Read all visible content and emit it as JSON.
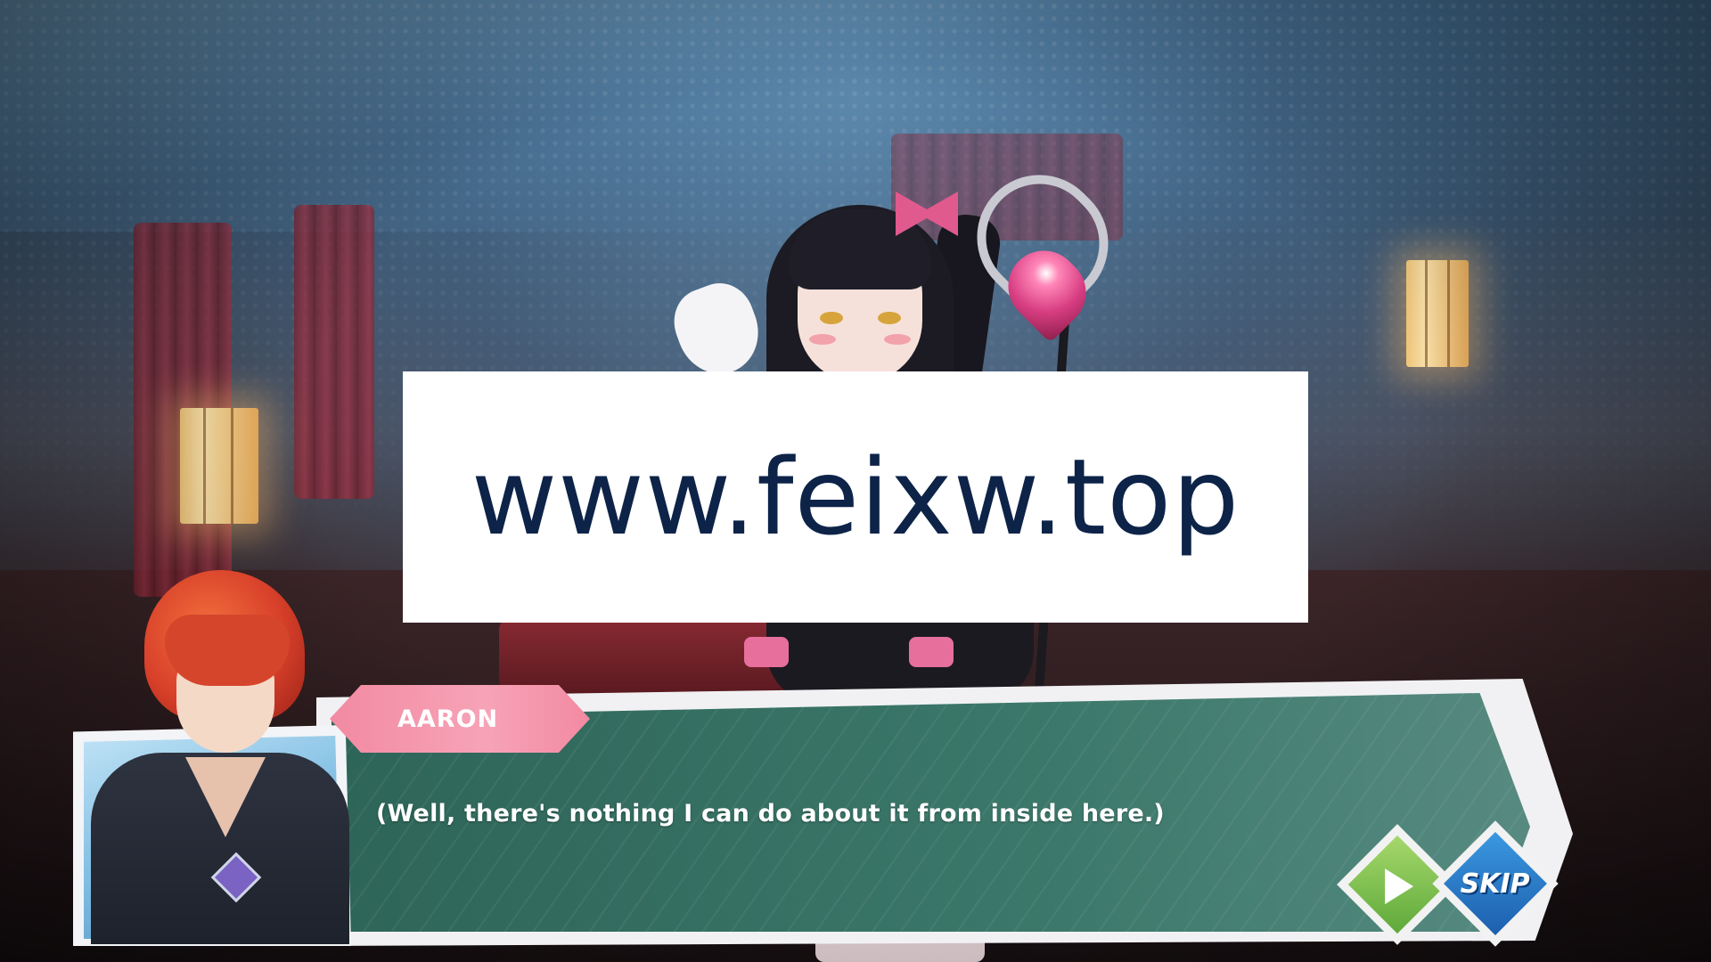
{
  "watermark": {
    "text": "www.feixw.top"
  },
  "dialogue": {
    "speaker": "AARON",
    "text": "(Well, there's nothing I can do about it from inside here.)"
  },
  "controls": {
    "play_icon": "play-triangle-icon",
    "skip_label": "SKIP"
  },
  "colors": {
    "dialog_panel": "#2c6e5f",
    "name_tag": "#f28aa2",
    "play_button": "#5ea93a",
    "skip_button": "#1c5fae"
  }
}
